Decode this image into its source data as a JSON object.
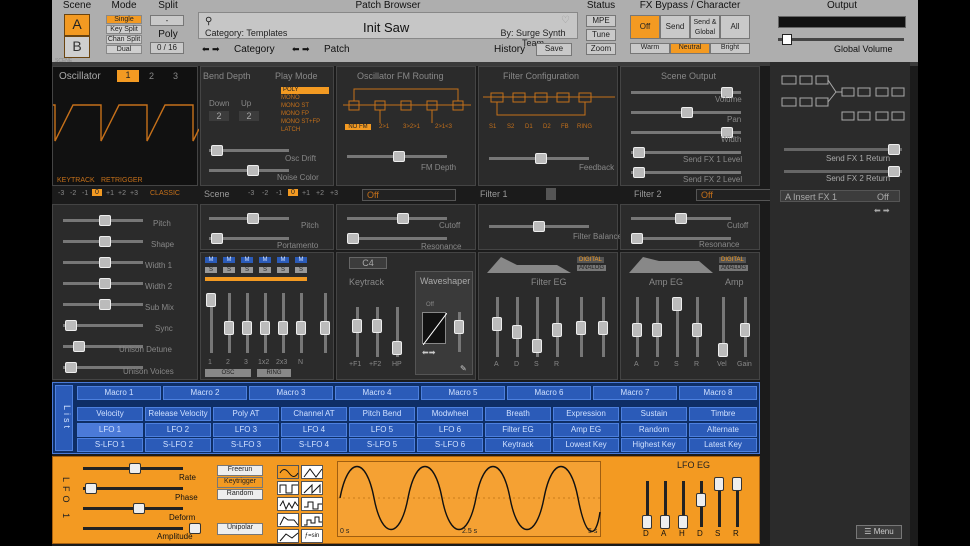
{
  "scene": {
    "title": "Scene",
    "a": "A",
    "b": "B"
  },
  "mode": {
    "title": "Mode",
    "items": [
      "Single",
      "Key Split",
      "Chan Split",
      "Dual"
    ]
  },
  "split": {
    "title": "Split",
    "value": "-",
    "poly_title": "Poly",
    "poly_value": "0 / 16"
  },
  "patch": {
    "title": "Patch Browser",
    "category": "Category: Templates",
    "name": "Init Saw",
    "author": "By: Surge Synth Team",
    "category_nav": "Category",
    "patch_nav": "Patch",
    "history": "History",
    "save": "Save"
  },
  "status": {
    "title": "Status",
    "items": [
      "MPE",
      "Tune",
      "Zoom"
    ]
  },
  "fx_bypass": {
    "title": "FX Bypass / Character",
    "items": [
      "Off",
      "Send",
      "Send & Global",
      "All"
    ],
    "character": [
      "Warm",
      "Neutral",
      "Bright"
    ]
  },
  "output": {
    "title": "Output",
    "volume": "Global Volume"
  },
  "section_label": "SCENE",
  "osc": {
    "title": "Oscillator",
    "nums": [
      "1",
      "2",
      "3"
    ],
    "keytrack": "KEYTRACK",
    "retrigger": "RETRIGGER",
    "octaves": [
      "-3",
      "-2",
      "-1",
      "0",
      "+1",
      "+2",
      "+3"
    ],
    "type": "CLASSIC"
  },
  "osc_params": [
    "Pitch",
    "Shape",
    "Width 1",
    "Width 2",
    "Sub Mix",
    "Sync",
    "Unison Detune",
    "Unison Voices"
  ],
  "bend": {
    "title": "Bend Depth",
    "down": "Down",
    "up": "Up",
    "down_val": "2",
    "up_val": "2"
  },
  "play": {
    "title": "Play Mode",
    "items": [
      "POLY",
      "MONO",
      "MONO ST",
      "MONO FP",
      "MONO ST+FP",
      "LATCH"
    ]
  },
  "osc_drift": "Osc Drift",
  "noise_color": "Noise Color",
  "fm": {
    "title": "Oscillator FM Routing",
    "items": [
      "NO FM",
      "2>1",
      "3>2>1",
      "2>1<3"
    ],
    "depth": "FM Depth"
  },
  "filter_config": {
    "title": "Filter Configuration",
    "items": [
      "S1",
      "S2",
      "D1",
      "D2",
      "FB",
      "RING"
    ],
    "feedback": "Feedback"
  },
  "scene_output": {
    "title": "Scene Output",
    "params": [
      "Volume",
      "Pan",
      "Width",
      "Send FX 1 Level",
      "Send FX 2 Level"
    ]
  },
  "scene_row": {
    "label": "Scene",
    "octaves": [
      "-3",
      "-2",
      "-1",
      "0",
      "+1",
      "+2",
      "+3"
    ],
    "filter1": "Filter 1",
    "filter2": "Filter 2",
    "off1": "Off",
    "off2": "Off"
  },
  "scene_params": [
    "Pitch",
    "Portamento"
  ],
  "filter1": {
    "cutoff": "Cutoff",
    "resonance": "Resonance"
  },
  "filter_balance": "Filter Balance",
  "filter2": {
    "cutoff": "Cutoff",
    "resonance": "Resonance"
  },
  "mixer": {
    "m_labels": [
      "M",
      "M",
      "M",
      "M",
      "M",
      "M"
    ],
    "s_labels": [
      "S",
      "S",
      "S",
      "S",
      "S",
      "S"
    ],
    "channels": [
      "1",
      "2",
      "3",
      "1x2",
      "2x3",
      "N"
    ],
    "osc": "OSC",
    "ring": "RING"
  },
  "keytrack": {
    "note": "C4",
    "title": "Keytrack",
    "channels": [
      "+F1",
      "+F2",
      "HP"
    ]
  },
  "waveshaper": {
    "title": "Waveshaper",
    "off": "Off"
  },
  "filter_eg": {
    "title": "Filter EG",
    "tag1": "DIGITAL",
    "tag2": "ANALOG",
    "channels": [
      "A",
      "D",
      "S",
      "R"
    ]
  },
  "amp_eg": {
    "title": "Amp EG",
    "amp": "Amp",
    "tag1": "DIGITAL",
    "tag2": "ANALOG",
    "channels": [
      "A",
      "D",
      "S",
      "R",
      "Vel",
      "Gain"
    ]
  },
  "macros": {
    "list": "List",
    "items": [
      "Macro 1",
      "Macro 2",
      "Macro 3",
      "Macro 4",
      "Macro 5",
      "Macro 6",
      "Macro 7",
      "Macro 8"
    ]
  },
  "mod_row1": [
    "Velocity",
    "Release Velocity",
    "Poly AT",
    "Channel AT",
    "Pitch Bend",
    "Modwheel",
    "Breath",
    "Expression",
    "Sustain",
    "Timbre"
  ],
  "mod_row2": [
    "LFO 1",
    "LFO 2",
    "LFO 3",
    "LFO 4",
    "LFO 5",
    "LFO 6",
    "Filter EG",
    "Amp EG",
    "Random",
    "Alternate"
  ],
  "mod_row3": [
    "S-LFO 1",
    "S-LFO 2",
    "S-LFO 3",
    "S-LFO 4",
    "S-LFO 5",
    "S-LFO 6",
    "Keytrack",
    "Lowest Key",
    "Highest Key",
    "Latest Key"
  ],
  "lfo": {
    "side": "LFO 1",
    "params": [
      "Rate",
      "Phase",
      "Deform",
      "Amplitude"
    ],
    "triggers": [
      "Freerun",
      "Keytrigger",
      "Random"
    ],
    "unipolar": "Unipolar",
    "ticks": [
      "0 s",
      "2.5 s",
      "5 s"
    ],
    "eg_title": "LFO EG",
    "eg_channels": [
      "D",
      "A",
      "H",
      "D",
      "S",
      "R"
    ]
  },
  "fx": {
    "send1": "Send FX 1 Return",
    "send2": "Send FX 2 Return",
    "slot": "A Insert FX 1",
    "off": "Off"
  },
  "menu": "Menu",
  "colors": {
    "orange": "#f39a22",
    "blue": "#2b5bb8",
    "panel": "#2b2b2b"
  }
}
